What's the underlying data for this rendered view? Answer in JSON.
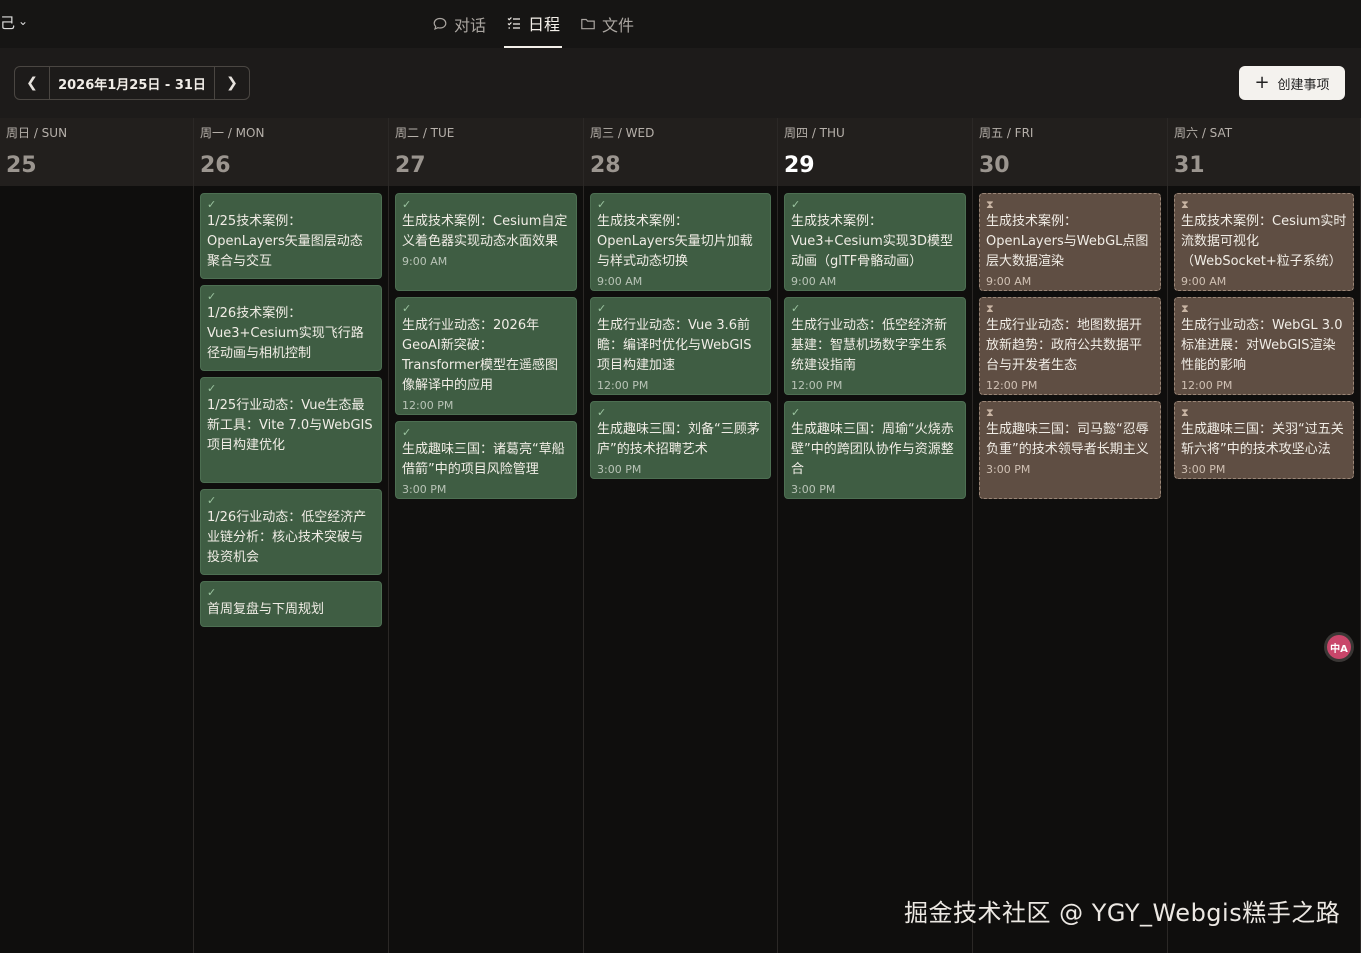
{
  "topbar": {
    "left_fragment": "己",
    "tabs": [
      {
        "label": "对话",
        "icon": "chat-bubble-icon"
      },
      {
        "label": "日程",
        "icon": "checklist-icon",
        "active": true
      },
      {
        "label": "文件",
        "icon": "folder-icon"
      }
    ]
  },
  "toolbar": {
    "date_range": "2026年1月25日 - 31日",
    "create_label": "创建事项"
  },
  "colors": {
    "done_bg": "#3f5d43",
    "pending_bg": "#5f4e43",
    "background": "#0f0e0d"
  },
  "days": [
    {
      "name": "周日 / SUN",
      "num": "25",
      "events": []
    },
    {
      "name": "周一 / MON",
      "num": "26",
      "events": [
        {
          "status": "done",
          "title": "1/25技术案例：OpenLayers矢量图层动态聚合与交互",
          "time": ""
        },
        {
          "status": "done",
          "title": "1/26技术案例：Vue3+Cesium实现飞行路径动画与相机控制",
          "time": ""
        },
        {
          "status": "done",
          "title": "1/25行业动态：Vue生态最新工具：Vite 7.0与WebGIS项目构建优化",
          "time": ""
        },
        {
          "status": "done",
          "title": "1/26行业动态：低空经济产业链分析：核心技术突破与投资机会",
          "time": ""
        },
        {
          "status": "done",
          "title": "首周复盘与下周规划",
          "time": ""
        }
      ]
    },
    {
      "name": "周二 / TUE",
      "num": "27",
      "events": [
        {
          "status": "done",
          "title": "生成技术案例：Cesium自定义着色器实现动态水面效果",
          "time": "9:00 AM"
        },
        {
          "status": "done",
          "title": "生成行业动态：2026年GeoAI新突破：Transformer模型在遥感图像解译中的应用",
          "time": "12:00 PM"
        },
        {
          "status": "done",
          "title": "生成趣味三国：诸葛亮“草船借箭”中的项目风险管理",
          "time": "3:00 PM"
        }
      ]
    },
    {
      "name": "周三 / WED",
      "num": "28",
      "events": [
        {
          "status": "done",
          "title": "生成技术案例：OpenLayers矢量切片加载与样式动态切换",
          "time": "9:00 AM"
        },
        {
          "status": "done",
          "title": "生成行业动态：Vue 3.6前瞻：编译时优化与WebGIS项目构建加速",
          "time": "12:00 PM"
        },
        {
          "status": "done",
          "title": "生成趣味三国：刘备“三顾茅庐”的技术招聘艺术",
          "time": "3:00 PM"
        }
      ]
    },
    {
      "name": "周四 / THU",
      "num": "29",
      "today": true,
      "events": [
        {
          "status": "done",
          "title": "生成技术案例：Vue3+Cesium实现3D模型动画（glTF骨骼动画）",
          "time": "9:00 AM"
        },
        {
          "status": "done",
          "title": "生成行业动态：低空经济新基建：智慧机场数字孪生系统建设指南",
          "time": "12:00 PM"
        },
        {
          "status": "done",
          "title": "生成趣味三国：周瑜“火烧赤壁”中的跨团队协作与资源整合",
          "time": "3:00 PM"
        }
      ]
    },
    {
      "name": "周五 / FRI",
      "num": "30",
      "events": [
        {
          "status": "pending",
          "title": "生成技术案例：OpenLayers与WebGL点图层大数据渲染",
          "time": "9:00 AM"
        },
        {
          "status": "pending",
          "title": "生成行业动态：地图数据开放新趋势：政府公共数据平台与开发者生态",
          "time": "12:00 PM"
        },
        {
          "status": "pending",
          "title": "生成趣味三国：司马懿“忍辱负重”的技术领导者长期主义",
          "time": "3:00 PM"
        }
      ]
    },
    {
      "name": "周六 / SAT",
      "num": "31",
      "events": [
        {
          "status": "pending",
          "title": "生成技术案例：Cesium实时流数据可视化（WebSocket+粒子系统）",
          "time": "9:00 AM"
        },
        {
          "status": "pending",
          "title": "生成行业动态：WebGL 3.0标准进展：对WebGIS渲染性能的影响",
          "time": "12:00 PM"
        },
        {
          "status": "pending",
          "title": "生成趣味三国：关羽“过五关斩六将”中的技术攻坚心法",
          "time": "3:00 PM"
        }
      ]
    }
  ],
  "translate_badge": "中A",
  "watermark": "掘金技术社区 @ YGY_Webgis糕手之路"
}
